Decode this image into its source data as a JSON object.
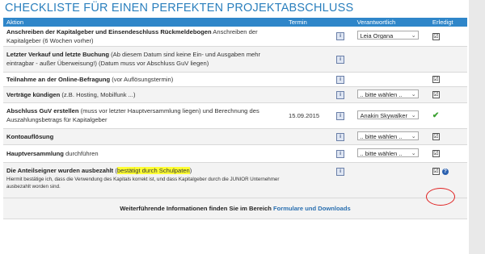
{
  "page": {
    "title": "CHECKLISTE FÜR EINEN PERFEKTEN PROJEKTABSCHLUSS"
  },
  "table": {
    "headers": {
      "aktion": "Aktion",
      "termin": "Termin",
      "verantwortlich": "Verantwortlich",
      "erledigt": "Erledigt"
    },
    "rows": [
      {
        "bold": "Anschreiben der Kapitalgeber und Einsendeschluss Rückmeldebogen",
        "text": " Anschreiben der Kapitalgeber (6 Wochen vorher)",
        "termin": "",
        "verantwortlich": "Leia Organa",
        "erledigt": "checkbox-checked"
      },
      {
        "bold": "Letzter Verkauf und letzte Buchung",
        "text": " (Ab diesem Datum sind keine Ein- und Ausgaben mehr eintragbar - außer Überweisung!) (Datum muss vor Abschluss GuV liegen)",
        "termin": "",
        "verantwortlich": "",
        "erledigt": ""
      },
      {
        "bold": "Teilnahme an der Online-Befragung",
        "text": " (vor Auflösungstermin)",
        "termin": "",
        "verantwortlich": "",
        "erledigt": "checkbox-checked"
      },
      {
        "bold": "Verträge kündigen",
        "text": " (z.B. Hosting, Mobilfunk ...)",
        "termin": "",
        "verantwortlich": ".. bitte wählen ..",
        "erledigt": "checkbox-checked"
      },
      {
        "bold": "Abschluss GuV erstellen",
        "text": " (muss vor letzter Hauptversammlung liegen) und Berechnung des Auszahlungsbetrags für Kapitalgeber",
        "termin": "15.09.2015",
        "verantwortlich": "Anakin Skywalker",
        "erledigt": "green-check"
      },
      {
        "bold": "Kontoauflösung",
        "text": "",
        "termin": "",
        "verantwortlich": ".. bitte wählen ..",
        "erledigt": "checkbox-checked"
      },
      {
        "bold": "Hauptversammlung",
        "text": " durchführen",
        "termin": "",
        "verantwortlich": ".. bitte wählen ..",
        "erledigt": "checkbox-checked"
      }
    ],
    "last_row": {
      "bold": "Die Anteilseigner wurden ausbezahlt",
      "paren_open": " (",
      "highlight": "bestätigt durch Schulpaten",
      "paren_close": ")",
      "note": "Hiermit bestätige ich, dass die Verwendung des Kapitals korrekt ist, und dass Kapitalgeber durch die JUNIOR Unternehmer ausbezahlt worden sind."
    },
    "footer": {
      "text": "Weiterführende Informationen finden Sie im Bereich ",
      "link": "Formulare und Downloads"
    }
  },
  "icons": {
    "info": "i",
    "help": "?",
    "checkbox_mark": "☑",
    "green_check": "✔",
    "chevron": "⌄"
  },
  "colors": {
    "header_bg": "#2f86c9",
    "title": "#2a7fbd",
    "highlight": "#ffff33",
    "annotation": "#e02020",
    "green": "#3aa030"
  }
}
